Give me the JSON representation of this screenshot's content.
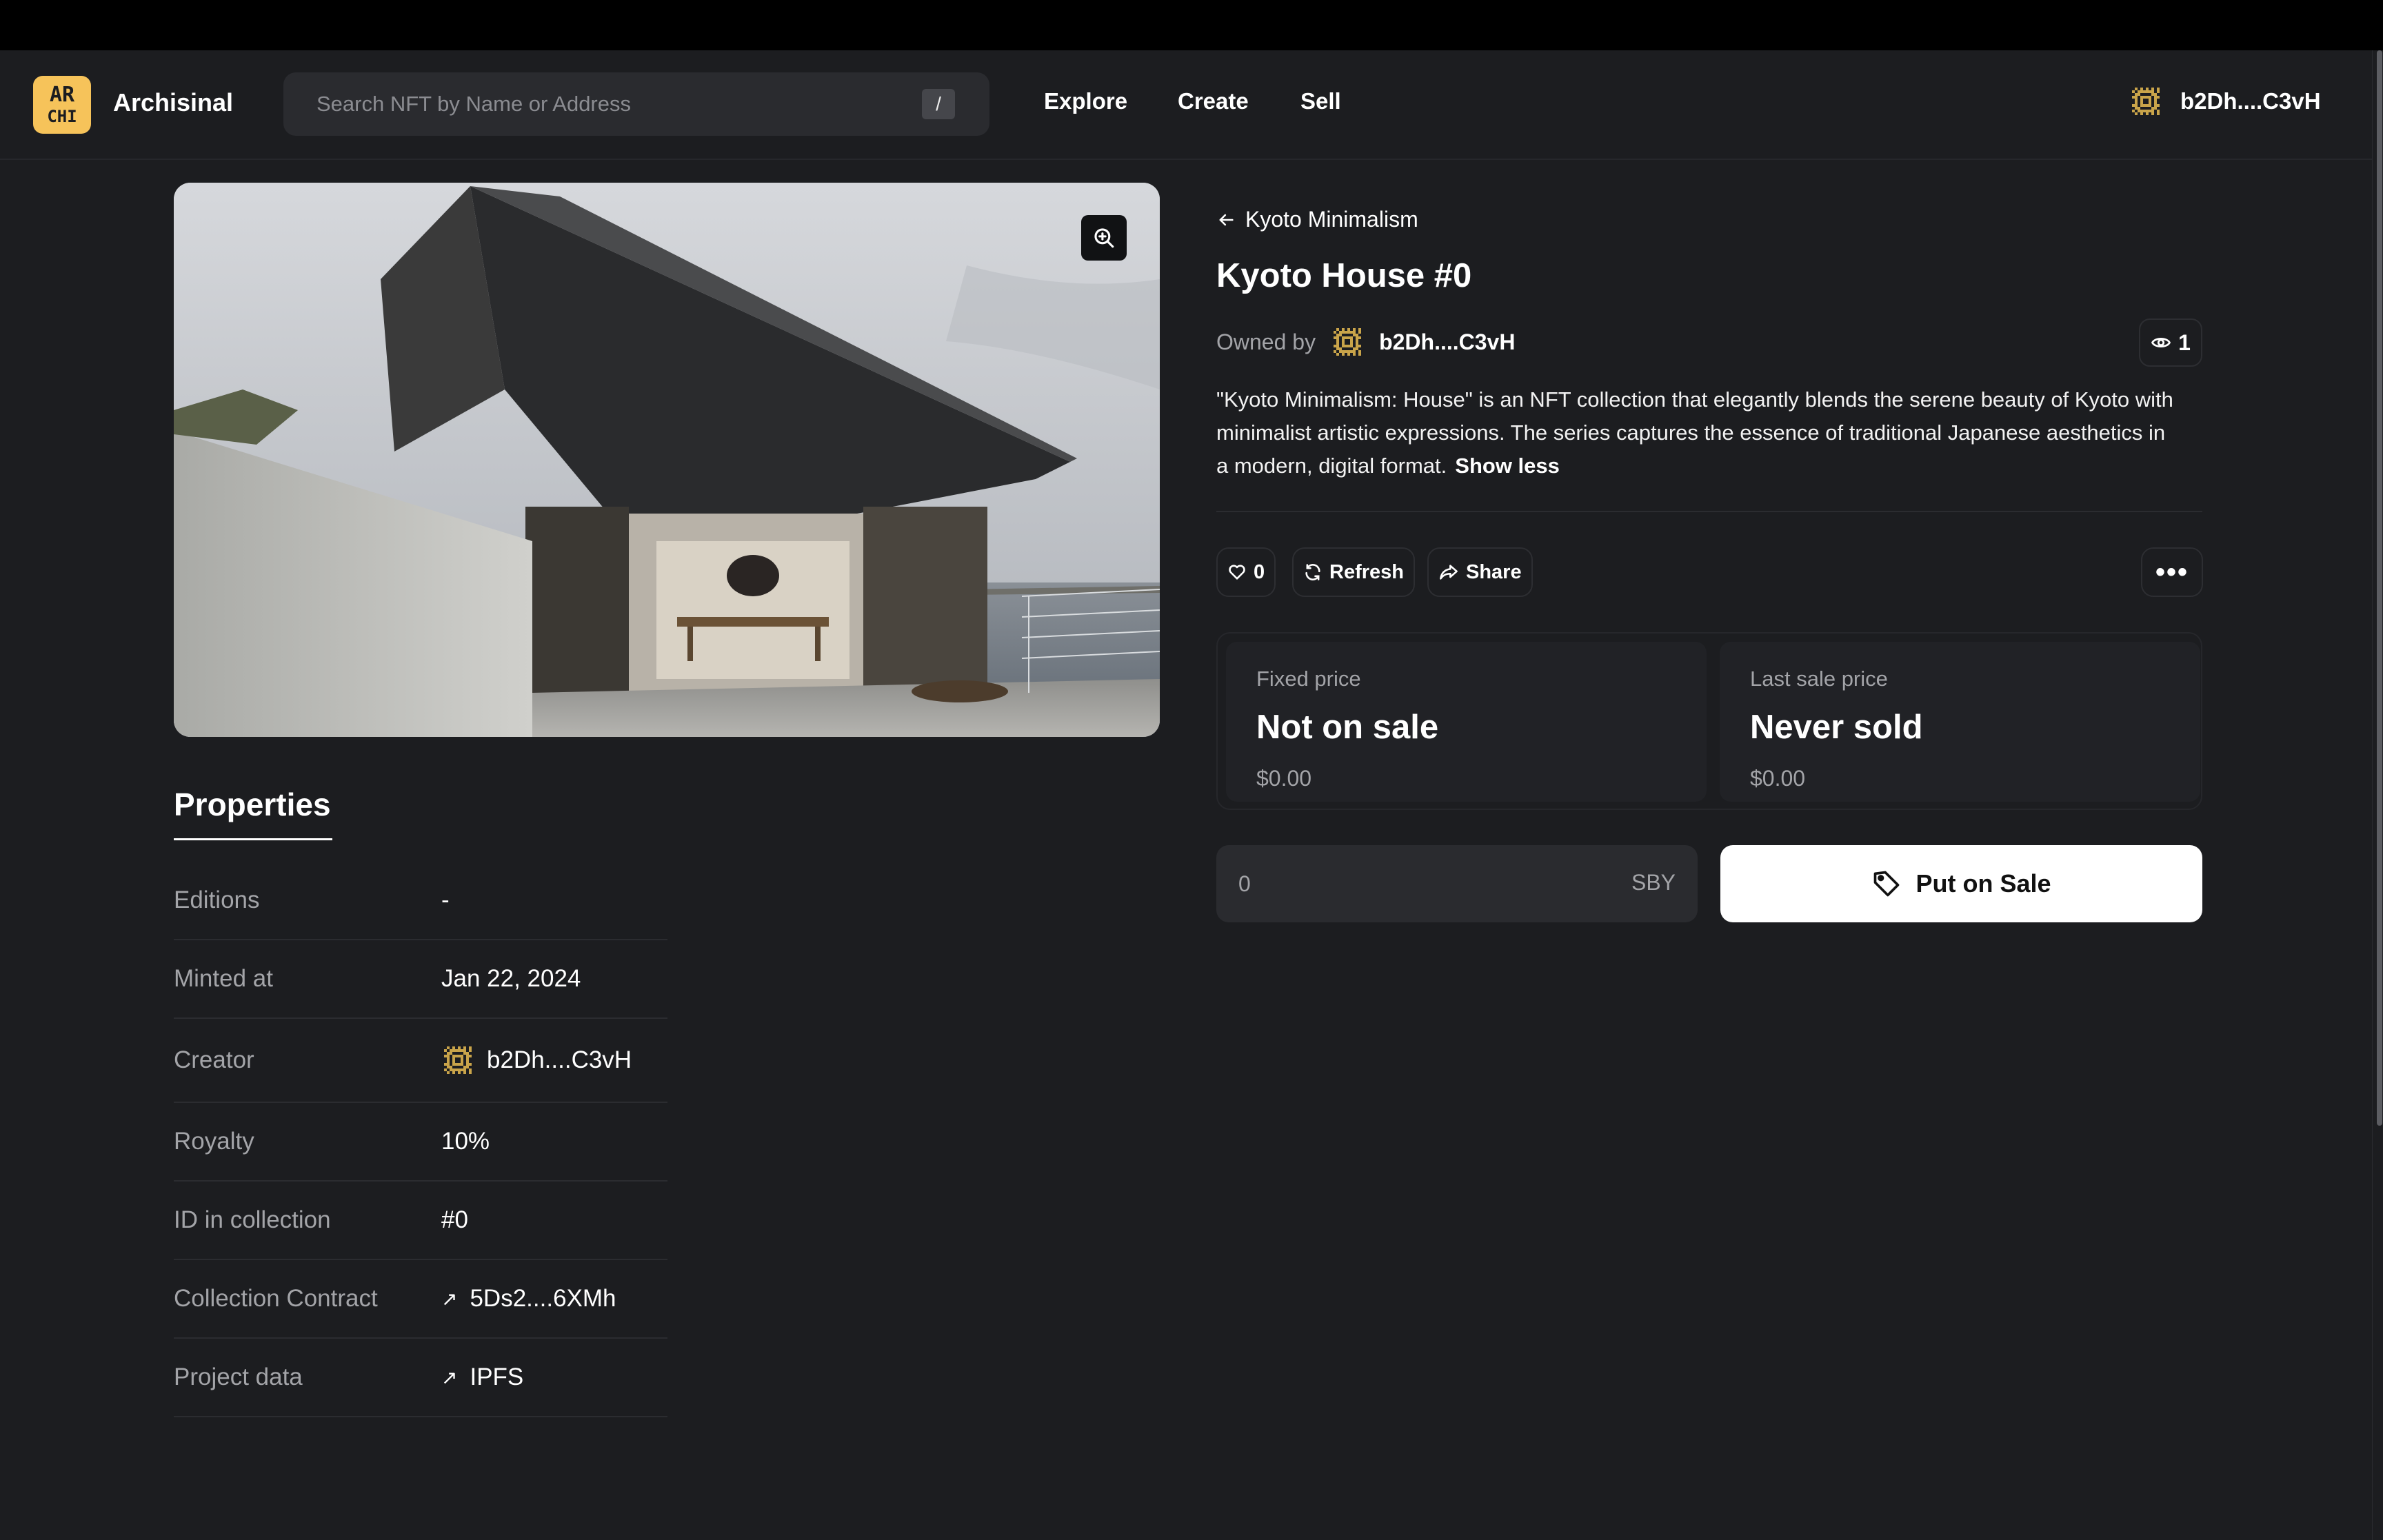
{
  "app": {
    "brand": "Archisinal",
    "logo_text": "AR\nCHI"
  },
  "search": {
    "placeholder": "Search NFT by Name or Address",
    "shortcut": "/"
  },
  "nav": {
    "explore": "Explore",
    "create": "Create",
    "sell": "Sell",
    "user": "b2Dh....C3vH"
  },
  "nft": {
    "collection": "Kyoto Minimalism",
    "title": "Kyoto House #0",
    "owned_by_label": "Owned by",
    "owner": "b2Dh....C3vH",
    "views": "1",
    "description": "\"Kyoto Minimalism: House\" is an NFT collection that elegantly blends the serene beauty of Kyoto with minimalist artistic expressions. The series captures the essence of traditional Japanese aesthetics in a modern, digital format.",
    "show_less": "Show less"
  },
  "actions": {
    "likes": "0",
    "refresh": "Refresh",
    "share": "Share",
    "more": "•••"
  },
  "prices": {
    "fixed_label": "Fixed price",
    "fixed_value": "Not on sale",
    "fixed_usd": "$0.00",
    "last_label": "Last sale price",
    "last_value": "Never sold",
    "last_usd": "$0.00"
  },
  "sale": {
    "input_placeholder": "0",
    "currency": "SBY",
    "button": "Put on Sale"
  },
  "properties": {
    "title": "Properties",
    "rows": [
      {
        "key": "Editions",
        "value": "-"
      },
      {
        "key": "Minted at",
        "value": "Jan 22, 2024"
      },
      {
        "key": "Creator",
        "value": "b2Dh....C3vH"
      },
      {
        "key": "Royalty",
        "value": "10%"
      },
      {
        "key": "ID in collection",
        "value": "#0"
      },
      {
        "key": "Collection Contract",
        "value": "5Ds2....6XMh"
      },
      {
        "key": "Project data",
        "value": "IPFS"
      }
    ]
  },
  "colors": {
    "background": "#1c1d20",
    "logo": "#f6c35a",
    "avatar": "#c9a44a"
  }
}
